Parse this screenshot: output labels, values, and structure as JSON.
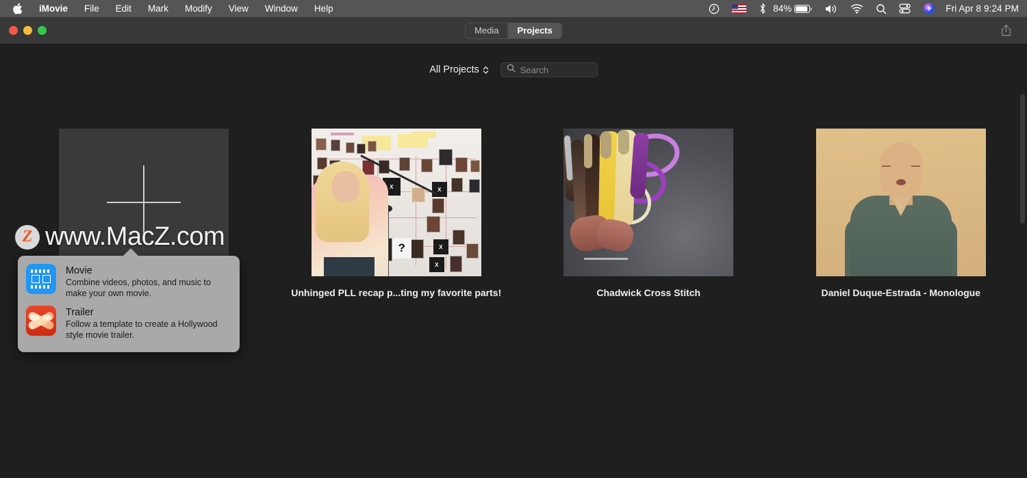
{
  "menubar": {
    "apple_icon": "apple-logo-icon",
    "items": [
      {
        "label": "iMovie",
        "bold": true
      },
      {
        "label": "File",
        "bold": false
      },
      {
        "label": "Edit",
        "bold": false
      },
      {
        "label": "Mark",
        "bold": false
      },
      {
        "label": "Modify",
        "bold": false
      },
      {
        "label": "View",
        "bold": false
      },
      {
        "label": "Window",
        "bold": false
      },
      {
        "label": "Help",
        "bold": false
      }
    ],
    "status": {
      "time_machine_icon": "clock-history-icon",
      "input_source_icon": "us-flag-icon",
      "bluetooth_icon": "bluetooth-icon",
      "battery_percent": "84%",
      "battery_icon": "battery-icon",
      "volume_icon": "speaker-icon",
      "wifi_icon": "wifi-icon",
      "spotlight_icon": "search-icon",
      "control_center_icon": "control-center-icon",
      "siri_icon": "siri-icon",
      "clock": "Fri Apr 8  9:24 PM"
    }
  },
  "toolbar": {
    "window_controls": [
      "close",
      "minimize",
      "zoom"
    ],
    "tabs": [
      {
        "label": "Media",
        "active": false
      },
      {
        "label": "Projects",
        "active": true
      }
    ],
    "share_icon": "share-icon"
  },
  "filterbar": {
    "filter_label": "All Projects",
    "filter_chevron_icon": "chevron-up-down-icon",
    "search_icon": "search-icon",
    "search_value": "",
    "search_placeholder": "Search"
  },
  "projects": [
    {
      "title": "",
      "type": "new-project-tile",
      "plus_icon": "plus-icon"
    },
    {
      "title": "Unhinged PLL recap p...ting my favorite parts!",
      "type": "project"
    },
    {
      "title": "Chadwick Cross Stitch",
      "type": "project"
    },
    {
      "title": "Daniel Duque-Estrada - Monologue",
      "type": "project"
    }
  ],
  "popover": {
    "options": [
      {
        "icon": "movie-filmstrip-icon",
        "title": "Movie",
        "description": "Combine videos, photos, and music to make your own movie."
      },
      {
        "icon": "trailer-searchlight-icon",
        "title": "Trailer",
        "description": "Follow a template to create a Hollywood style movie trailer."
      }
    ]
  },
  "watermark": {
    "logo_letter": "Z",
    "text": "www.MacZ.com"
  },
  "colors": {
    "menubar": "#555556",
    "toolbar": "#383838",
    "content_bg": "#1f1f1f",
    "popover_bg": "#a9a9a9",
    "accent_blue": "#2196f3",
    "accent_red": "#e8462a",
    "watermark_orange": "#f05a28"
  }
}
